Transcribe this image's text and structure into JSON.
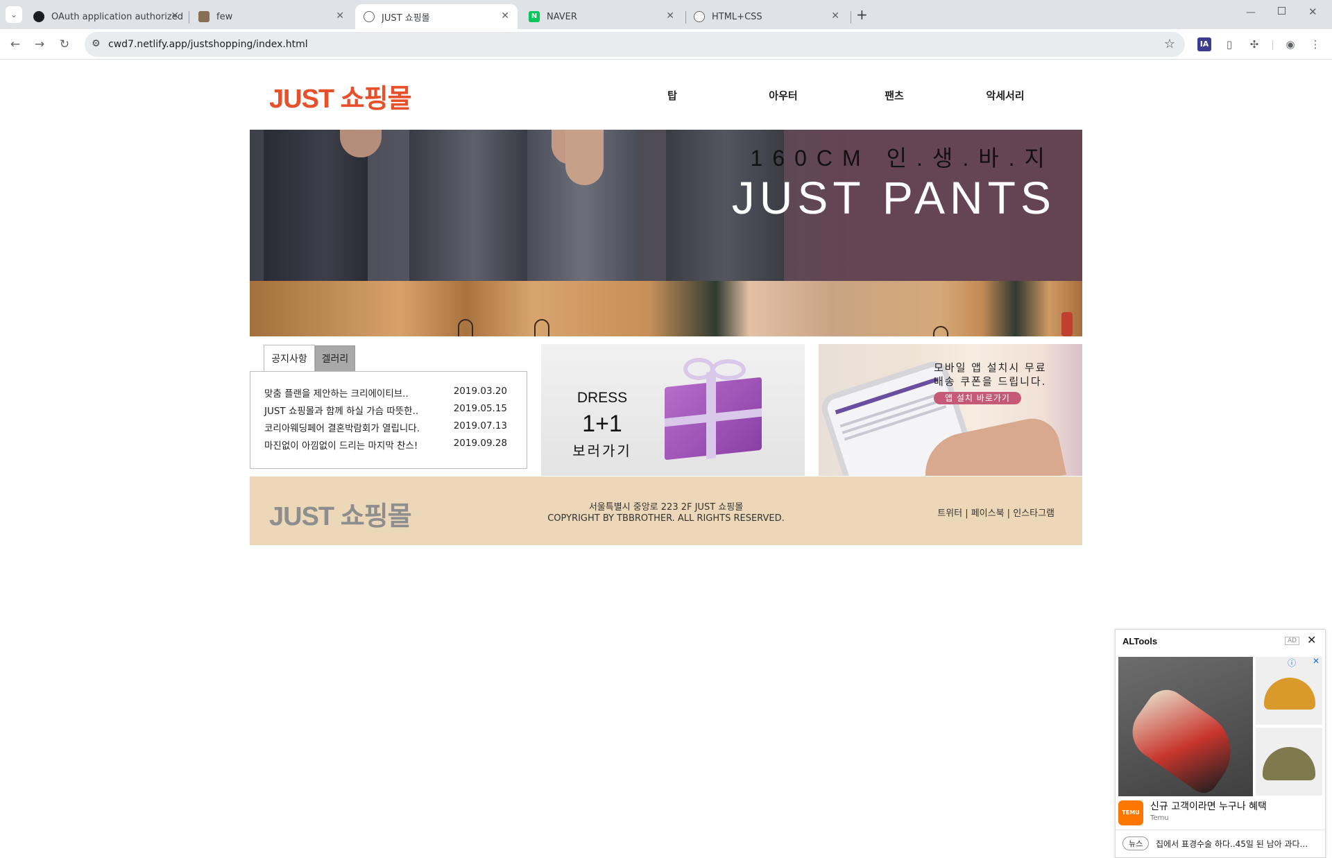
{
  "browser": {
    "tabs": [
      {
        "title": "OAuth application authorized",
        "active": false
      },
      {
        "title": "few",
        "active": false
      },
      {
        "title": "JUST 쇼핑몰",
        "active": true
      },
      {
        "title": "NAVER",
        "active": false
      },
      {
        "title": "HTML+CSS",
        "active": false
      }
    ],
    "new_tab": "+",
    "url": "cwd7.netlify.app/justshopping/index.html",
    "ext_ia": "IA"
  },
  "site": {
    "logo": "JUST 쇼핑몰",
    "menu": [
      "탑",
      "아우터",
      "팬츠",
      "악세서리"
    ],
    "hero": {
      "subtitle": "160CM 인.생.바.지",
      "title": "JUST PANTS"
    },
    "notice_tabs": [
      "공지사항",
      "겔러리"
    ],
    "notices": [
      {
        "title": "맞춤 플랜을 제안하는 크리에이티브..",
        "date": "2019.03.20"
      },
      {
        "title": "JUST 쇼핑몰과 함께 하실 가슴 따뜻한..",
        "date": "2019.05.15"
      },
      {
        "title": "코리아웨딩페어 결혼박람회가 열립니다.",
        "date": "2019.07.13"
      },
      {
        "title": "마진없이 아낌없이 드리는 마지막 찬스!",
        "date": "2019.09.28"
      }
    ],
    "dress_banner": {
      "line1": "DRESS",
      "line2": "1+1",
      "line3": "보러가기"
    },
    "app_banner": {
      "line1": "모바일 앱 설치시 무료",
      "line2": "배송 쿠폰을 드립니다.",
      "button": "앱 설치 바로가기"
    },
    "footer": {
      "logo": "JUST 쇼핑몰",
      "address": "서울특별시 중앙로 223 2F JUST 쇼핑몰",
      "copyright": "COPYRIGHT BY TBBROTHER. ALL RIGHTS RESERVED.",
      "social": "트위터 | 페이스북 | 인스타그램"
    }
  },
  "ad": {
    "brand": "ALTools",
    "ad_label": "AD",
    "product_title": "신규 고객이라면 누구나 혜택",
    "product_source": "Temu",
    "temu_logo": "TEMU",
    "news_badge": "뉴스",
    "news_text": "집에서 표경수술 하다..45일 된 남아 과다..."
  },
  "colors": {
    "logo": "#e7502a",
    "footer_bg": "#ecd7b8",
    "footer_logo": "#8e8e8e",
    "app_btn": "#c55a78"
  }
}
